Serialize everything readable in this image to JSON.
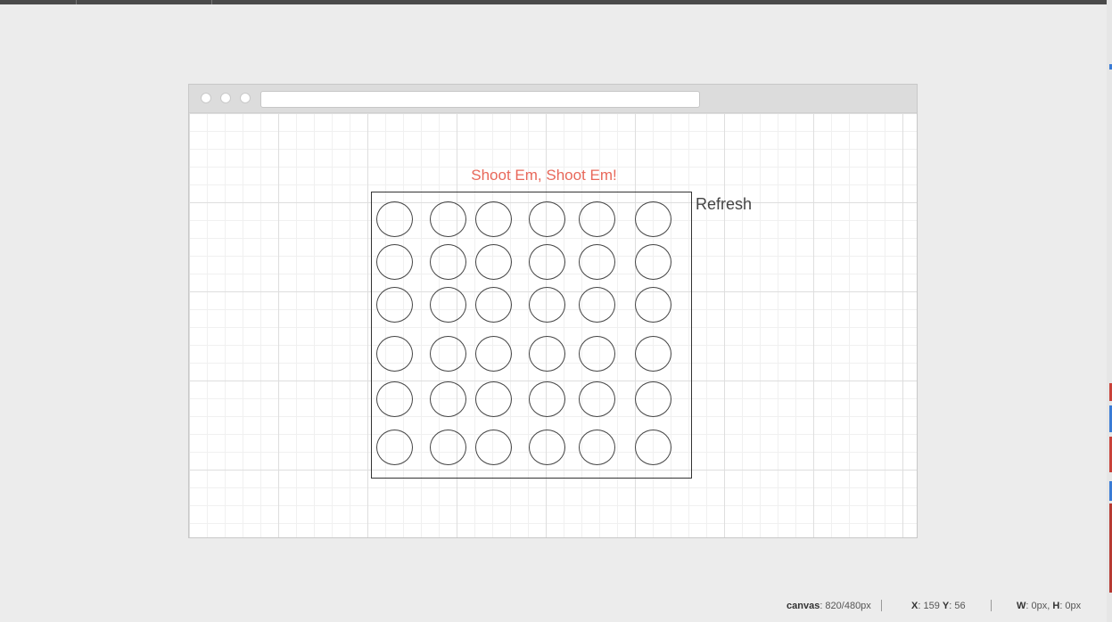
{
  "colors": {
    "title": "#e8685a",
    "background": "#ececec",
    "topbar": "#4a4a4a"
  },
  "game": {
    "title": "Shoot Em, Shoot Em!",
    "refresh_label": "Refresh",
    "target_rows": 6,
    "target_cols": 6
  },
  "status": {
    "canvas_label": "canvas",
    "canvas_value": ": 820/480px",
    "x_label": "X",
    "x_value": ": 159 ",
    "y_label": "Y",
    "y_value": ": 56",
    "w_label": "W",
    "w_value": ": 0px, ",
    "h_label": "H",
    "h_value": ": 0px"
  }
}
